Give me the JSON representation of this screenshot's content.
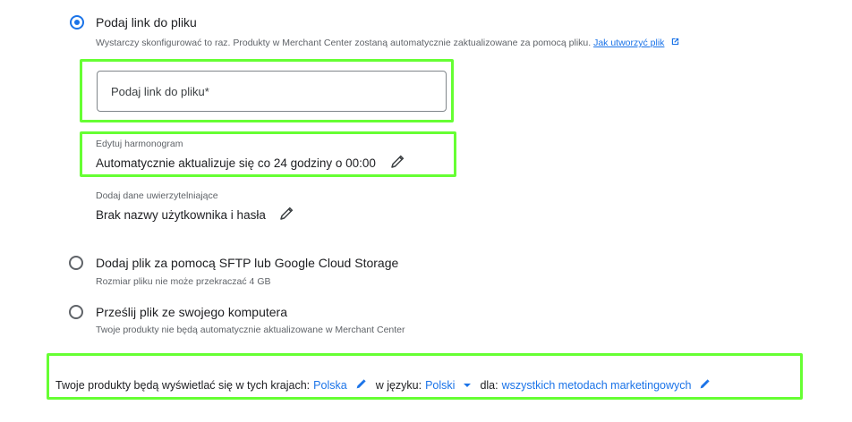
{
  "option_link": {
    "title": "Podaj link do pliku",
    "desc": "Wystarczy skonfigurować to raz. Produkty w Merchant Center zostaną automatycznie zaktualizowane za pomocą pliku.",
    "help_link": "Jak utworzyć plik",
    "checked": true
  },
  "url_input": {
    "placeholder": "Podaj link do pliku*",
    "value": ""
  },
  "schedule": {
    "label": "Edytuj harmonogram",
    "value": "Automatycznie aktualizuje się co 24 godziny o 00:00"
  },
  "credentials": {
    "label": "Dodaj dane uwierzytelniające",
    "value": "Brak nazwy użytkownika i hasła"
  },
  "option_sftp": {
    "title": "Dodaj plik za pomocą SFTP lub Google Cloud Storage",
    "desc": "Rozmiar pliku nie może przekraczać 4 GB",
    "checked": false
  },
  "option_upload": {
    "title": "Prześlij plik ze swojego komputera",
    "desc": "Twoje produkty nie będą automatycznie aktualizowane w Merchant Center",
    "checked": false
  },
  "targeting": {
    "countries_prefix": "Twoje produkty będą wyświetlać się w tych krajach:",
    "country": "Polska",
    "language_prefix": "w języku:",
    "language": "Polski",
    "destination_prefix": "dla:",
    "destination": "wszystkich metodach marketingowych"
  },
  "colors": {
    "accent": "#1a73e8",
    "highlight": "#66ff33"
  },
  "icons": [
    "radio-button",
    "external-link-icon",
    "pencil-icon",
    "dropdown-arrow-icon"
  ]
}
